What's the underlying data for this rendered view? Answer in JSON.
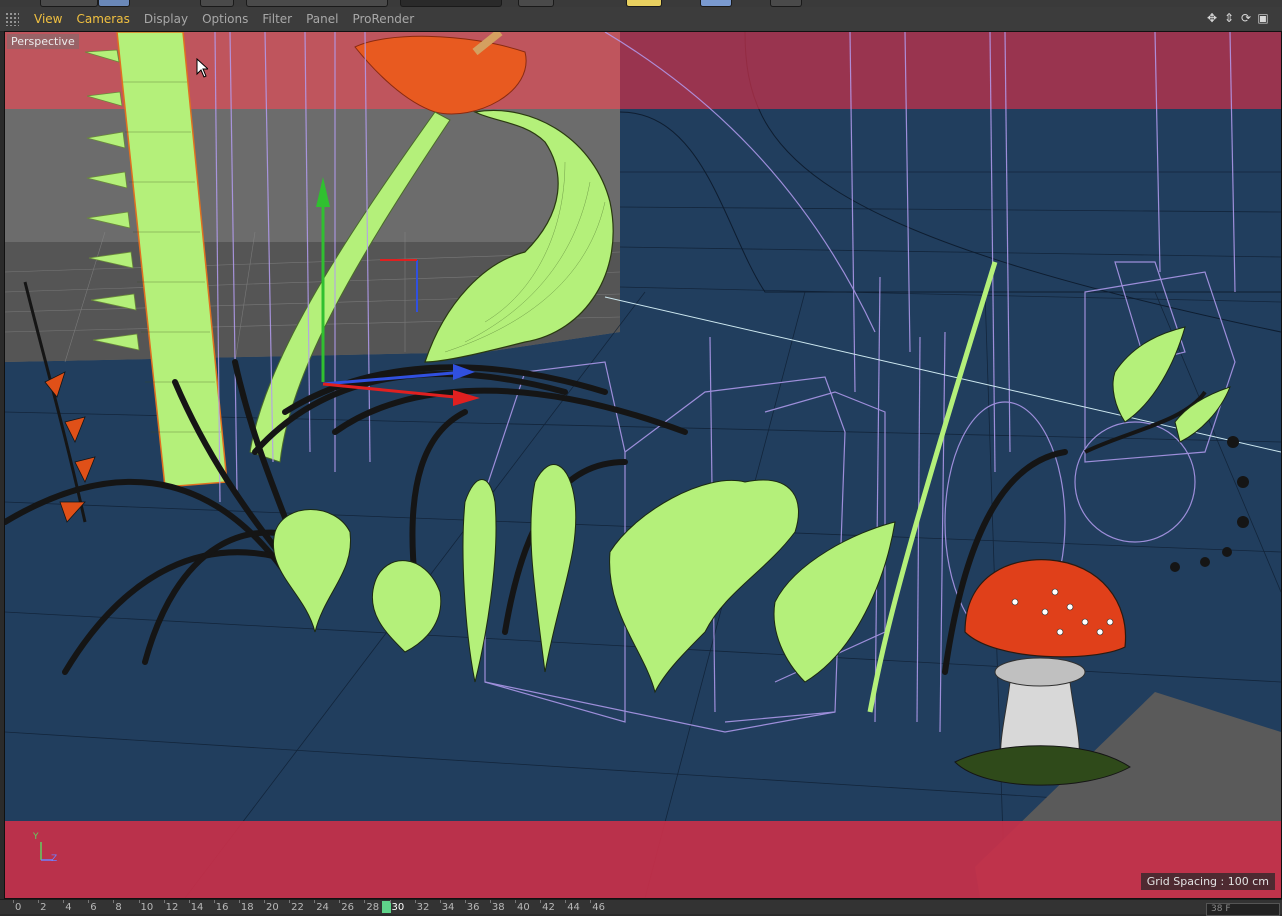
{
  "menu": {
    "items": [
      {
        "label": "View",
        "active": true
      },
      {
        "label": "Cameras",
        "active": true
      },
      {
        "label": "Display",
        "active": false
      },
      {
        "label": "Options",
        "active": false
      },
      {
        "label": "Filter",
        "active": false
      },
      {
        "label": "Panel",
        "active": false
      },
      {
        "label": "ProRender",
        "active": false
      }
    ],
    "nav_icons": [
      "move-view-icon",
      "dolly-view-icon",
      "rotate-view-icon",
      "toggle-view-icon"
    ]
  },
  "viewport": {
    "camera_label": "Perspective",
    "grid_spacing": "Grid Spacing : 100 cm",
    "axis_labels": {
      "y": "Y",
      "z": "Z"
    }
  },
  "timeline": {
    "ticks": [
      "0",
      "2",
      "4",
      "6",
      "8",
      "10",
      "12",
      "14",
      "16",
      "18",
      "20",
      "22",
      "24",
      "26",
      "28",
      "30",
      "32",
      "34",
      "36",
      "38",
      "40",
      "42",
      "44",
      "46"
    ],
    "current_frame": "30",
    "end_field": "38 F"
  },
  "colors": {
    "menu_active": "#f0c040",
    "safe_frame": "#c8304a",
    "floor": "#213e5e",
    "leaf": "#b4f07a",
    "wire": "#b39cf0",
    "mushroom_cap": "#e0401a",
    "frame_marker": "#5fd38a"
  }
}
